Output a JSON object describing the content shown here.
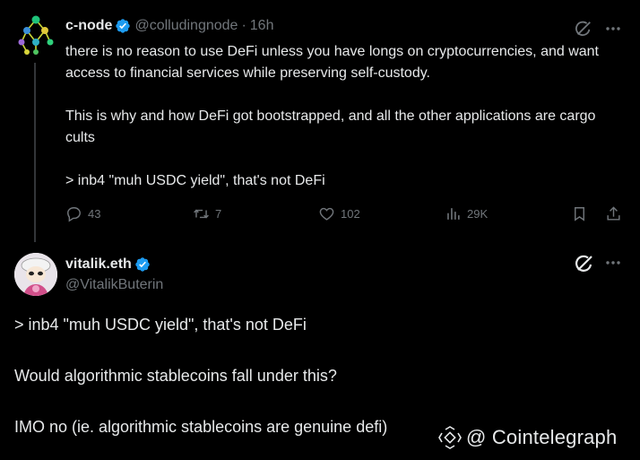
{
  "tweet1": {
    "display_name": "c-node",
    "handle": "@colludingnode",
    "separator": "·",
    "time": "16h",
    "lines": [
      "there is no reason to use DeFi unless you have longs on cryptocurrencies, and want access to financial services while preserving self-custody.",
      "This is why and how DeFi got bootstrapped, and all the other applications are cargo cults",
      "> inb4 \"muh USDC yield\", that's not DeFi"
    ],
    "replies": "43",
    "reposts": "7",
    "likes": "102",
    "views": "29K"
  },
  "tweet2": {
    "display_name": "vitalik.eth",
    "handle": "@VitalikButerin",
    "lines": [
      "> inb4 \"muh USDC yield\", that's not DeFi",
      "Would algorithmic stablecoins fall under this?",
      "IMO no (ie. algorithmic stablecoins are genuine defi)"
    ]
  },
  "watermark": {
    "text": "@ Cointelegraph"
  },
  "colors": {
    "background": "#000000",
    "text": "#e7e9ea",
    "muted": "#71767b",
    "verified": "#1d9bf0"
  }
}
